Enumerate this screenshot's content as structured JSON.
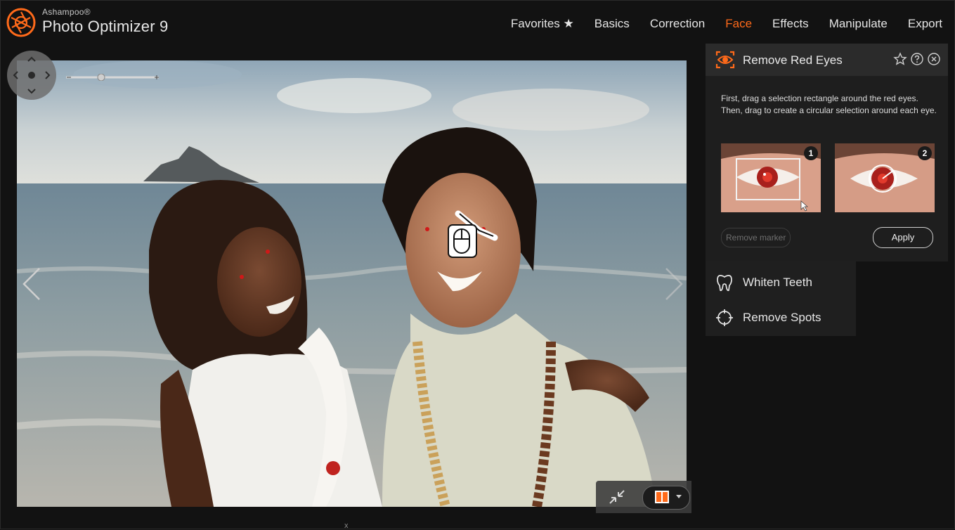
{
  "app": {
    "vendor": "Ashampoo®",
    "name": "Photo Optimizer 9"
  },
  "nav": {
    "items": [
      {
        "label": "Favorites ★"
      },
      {
        "label": "Basics"
      },
      {
        "label": "Correction"
      },
      {
        "label": "Face",
        "active": true
      },
      {
        "label": "Effects"
      },
      {
        "label": "Manipulate"
      },
      {
        "label": "Export"
      }
    ]
  },
  "colors": {
    "accent": "#ff6a1a",
    "background": "#121212"
  },
  "panel": {
    "title": "Remove Red Eyes",
    "title_icon": "red-eye-icon",
    "instructions": "First, drag a selection rectangle around the red eyes. Then, drag to create a circular selection around each eye.",
    "examples": [
      {
        "number": "1"
      },
      {
        "number": "2"
      }
    ],
    "remove_marker_label": "Remove marker",
    "apply_label": "Apply",
    "actions": [
      "favorite-star-icon",
      "help-icon",
      "close-icon"
    ]
  },
  "tools": [
    {
      "label": "Whiten Teeth",
      "icon": "tooth-icon"
    },
    {
      "label": "Remove Spots",
      "icon": "crosshair-icon"
    }
  ],
  "canvas": {
    "zoom_min": "−",
    "zoom_max": "+",
    "scroll_indicator": "x"
  }
}
